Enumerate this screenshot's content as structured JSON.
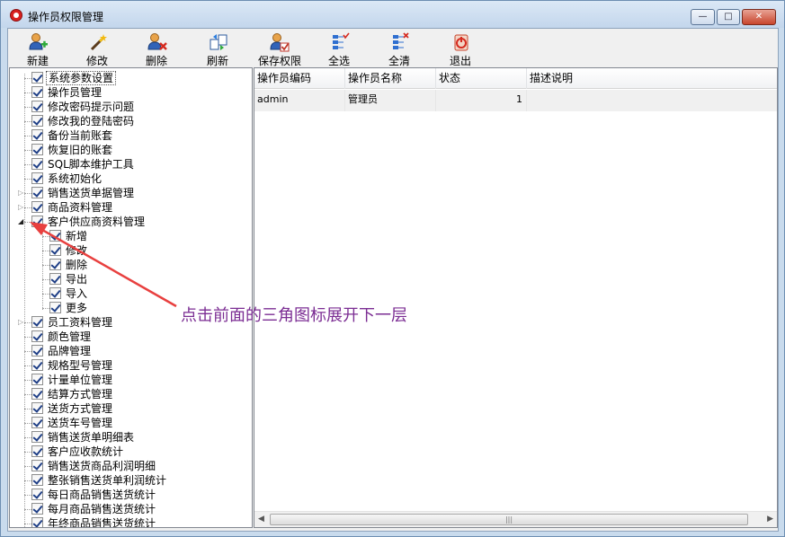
{
  "window": {
    "title": "操作员权限管理",
    "controls": {
      "minimize": "—",
      "maximize": "□",
      "close": "✕"
    }
  },
  "toolbar": {
    "buttons": [
      {
        "label": "新建",
        "icon": "user-add-icon"
      },
      {
        "label": "修改",
        "icon": "magic-wand-icon"
      },
      {
        "label": "删除",
        "icon": "user-delete-icon"
      },
      {
        "label": "刷新",
        "icon": "refresh-icon"
      },
      {
        "label": "保存权限",
        "icon": "user-save-icon"
      },
      {
        "label": "全选",
        "icon": "select-all-icon"
      },
      {
        "label": "全清",
        "icon": "clear-all-icon"
      },
      {
        "label": "退出",
        "icon": "exit-icon"
      }
    ]
  },
  "tree": {
    "items": [
      {
        "label": "系统参数设置",
        "checked": true,
        "expander": "none",
        "selected": true
      },
      {
        "label": "操作员管理",
        "checked": true,
        "expander": "none"
      },
      {
        "label": "修改密码提示问题",
        "checked": true,
        "expander": "none"
      },
      {
        "label": "修改我的登陆密码",
        "checked": true,
        "expander": "none"
      },
      {
        "label": "备份当前账套",
        "checked": true,
        "expander": "none"
      },
      {
        "label": "恢复旧的账套",
        "checked": true,
        "expander": "none"
      },
      {
        "label": "SQL脚本维护工具",
        "checked": true,
        "expander": "none"
      },
      {
        "label": "系统初始化",
        "checked": true,
        "expander": "none"
      },
      {
        "label": "销售送货单据管理",
        "checked": true,
        "expander": "collapsed"
      },
      {
        "label": "商品资料管理",
        "checked": true,
        "expander": "collapsed"
      },
      {
        "label": "客户供应商资料管理",
        "checked": true,
        "expander": "expanded"
      },
      {
        "label": "新增",
        "checked": true,
        "expander": "none",
        "child": true
      },
      {
        "label": "修改",
        "checked": true,
        "expander": "none",
        "child": true
      },
      {
        "label": "删除",
        "checked": true,
        "expander": "none",
        "child": true
      },
      {
        "label": "导出",
        "checked": true,
        "expander": "none",
        "child": true
      },
      {
        "label": "导入",
        "checked": true,
        "expander": "none",
        "child": true
      },
      {
        "label": "更多",
        "checked": true,
        "expander": "none",
        "child": true
      },
      {
        "label": "员工资料管理",
        "checked": true,
        "expander": "collapsed"
      },
      {
        "label": "颜色管理",
        "checked": true,
        "expander": "none"
      },
      {
        "label": "品牌管理",
        "checked": true,
        "expander": "none"
      },
      {
        "label": "规格型号管理",
        "checked": true,
        "expander": "none"
      },
      {
        "label": "计量单位管理",
        "checked": true,
        "expander": "none"
      },
      {
        "label": "结算方式管理",
        "checked": true,
        "expander": "none"
      },
      {
        "label": "送货方式管理",
        "checked": true,
        "expander": "none"
      },
      {
        "label": "送货车号管理",
        "checked": true,
        "expander": "none"
      },
      {
        "label": "销售送货单明细表",
        "checked": true,
        "expander": "none"
      },
      {
        "label": "客户应收款统计",
        "checked": true,
        "expander": "none"
      },
      {
        "label": "销售送货商品利润明细",
        "checked": true,
        "expander": "none"
      },
      {
        "label": "整张销售送货单利润统计",
        "checked": true,
        "expander": "none"
      },
      {
        "label": "每日商品销售送货统计",
        "checked": true,
        "expander": "none"
      },
      {
        "label": "每月商品销售送货统计",
        "checked": true,
        "expander": "none"
      },
      {
        "label": "年终商品销售送货统计",
        "checked": true,
        "expander": "none"
      }
    ]
  },
  "grid": {
    "columns": [
      "操作员编码",
      "操作员名称",
      "状态",
      "描述说明"
    ],
    "rows": [
      [
        "admin",
        "管理员",
        "1",
        ""
      ]
    ],
    "scroll": {
      "left": "◀",
      "right": "▶",
      "thumb": "|||"
    }
  },
  "annotation": {
    "text": "点击前面的三角图标展开下一层",
    "color": "#7b2d93",
    "arrow_color": "#e8403f"
  }
}
